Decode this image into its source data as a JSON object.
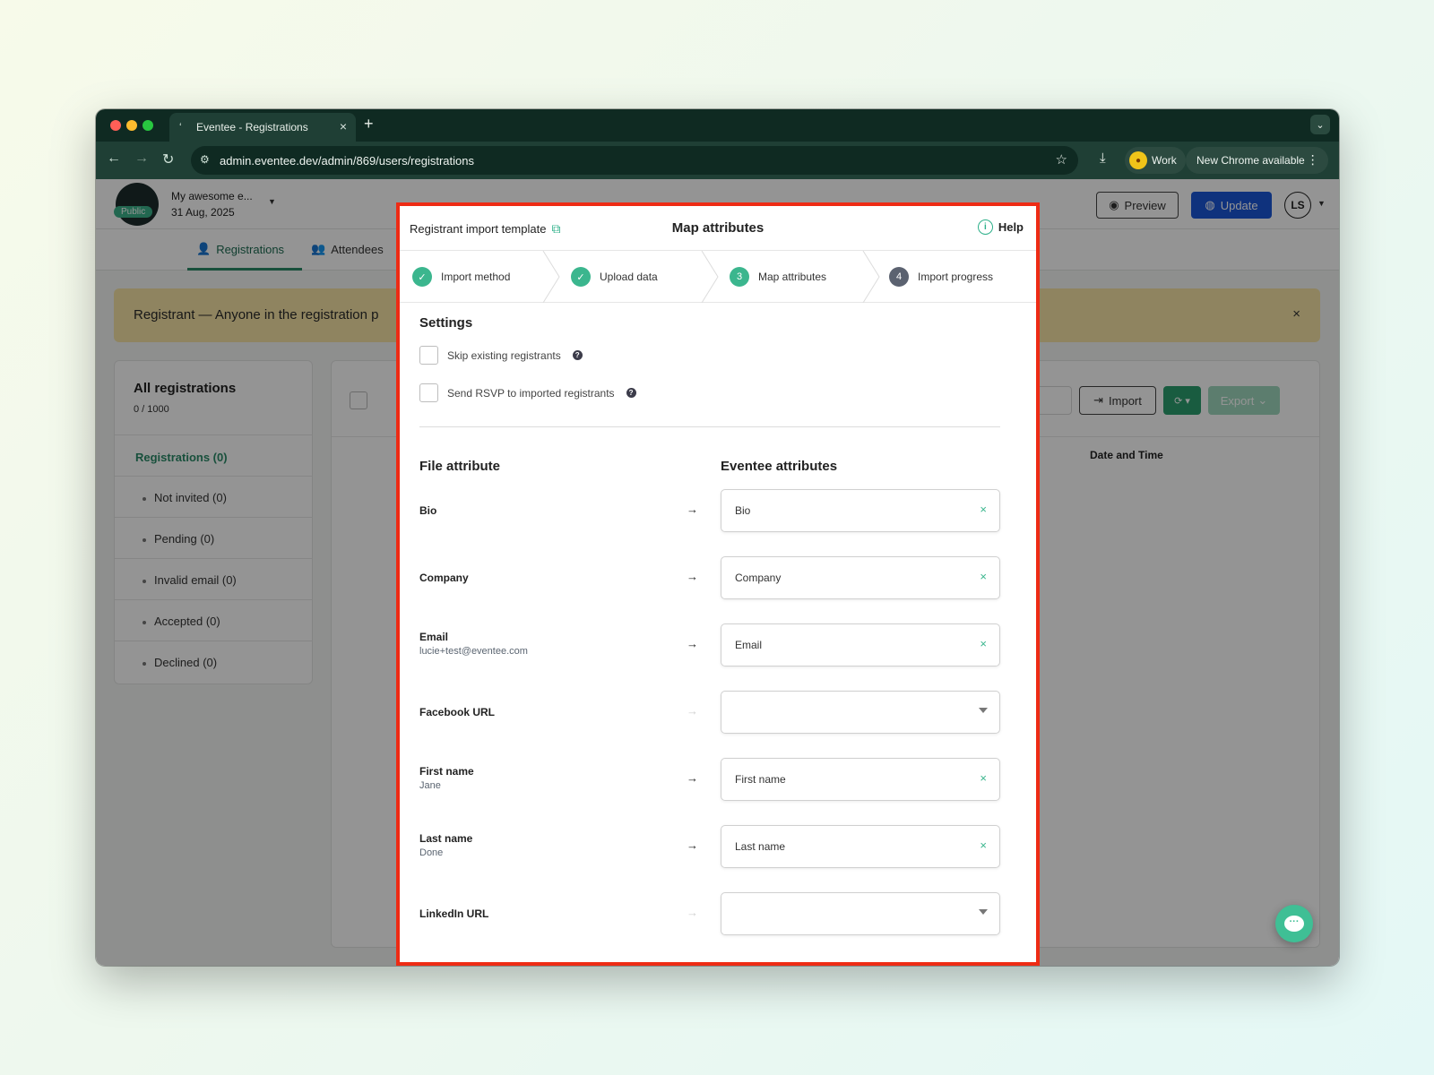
{
  "browser": {
    "tab_title": "Eventee - Registrations",
    "url": "admin.eventee.dev/admin/869/users/registrations",
    "profile_label": "Work",
    "update_label": "New Chrome available"
  },
  "app": {
    "event_name": "My awesome e...",
    "event_date": "31 Aug, 2025",
    "public_badge": "Public",
    "preview_label": "Preview",
    "update_label": "Update",
    "user_initials": "LS",
    "tabs": [
      {
        "label": "Registrations"
      },
      {
        "label": "Attendees"
      }
    ],
    "banner_text": "Registrant — Anyone in the registration p",
    "sidebar": {
      "title": "All registrations",
      "count": "0 / 1000",
      "active_item": "Registrations (0)",
      "items": [
        {
          "label": "Not invited (0)"
        },
        {
          "label": "Pending (0)"
        },
        {
          "label": "Invalid email (0)"
        },
        {
          "label": "Accepted (0)"
        },
        {
          "label": "Declined (0)"
        }
      ]
    },
    "toolbar": {
      "import_label": "Import",
      "export_label": "Export"
    },
    "table": {
      "date_column": "Date and Time"
    }
  },
  "modal": {
    "template_link": "Registrant import template",
    "title": "Map attributes",
    "help_label": "Help",
    "steps": [
      {
        "label": "Import method",
        "state": "done",
        "number": ""
      },
      {
        "label": "Upload data",
        "state": "done",
        "number": ""
      },
      {
        "label": "Map attributes",
        "state": "current",
        "number": "3"
      },
      {
        "label": "Import progress",
        "state": "todo",
        "number": "4"
      }
    ],
    "settings_title": "Settings",
    "settings": [
      {
        "label": "Skip existing registrants",
        "checked": false
      },
      {
        "label": "Send RSVP to imported registrants",
        "checked": false
      }
    ],
    "file_attribute_header": "File attribute",
    "eventee_attributes_header": "Eventee attributes",
    "mappings": [
      {
        "file_attr": "Bio",
        "sample": "",
        "target": "Bio",
        "mapped": true
      },
      {
        "file_attr": "Company",
        "sample": "",
        "target": "Company",
        "mapped": true
      },
      {
        "file_attr": "Email",
        "sample": "lucie+test@eventee.com",
        "target": "Email",
        "mapped": true
      },
      {
        "file_attr": "Facebook URL",
        "sample": "",
        "target": "",
        "mapped": false
      },
      {
        "file_attr": "First name",
        "sample": "Jane",
        "target": "First name",
        "mapped": true
      },
      {
        "file_attr": "Last name",
        "sample": "Done",
        "target": "Last name",
        "mapped": true
      },
      {
        "file_attr": "LinkedIn URL",
        "sample": "",
        "target": "",
        "mapped": false
      }
    ]
  },
  "colors": {
    "accent_green": "#3bb68e",
    "highlight_border": "#ee2b14",
    "update_blue": "#1a56d8"
  }
}
